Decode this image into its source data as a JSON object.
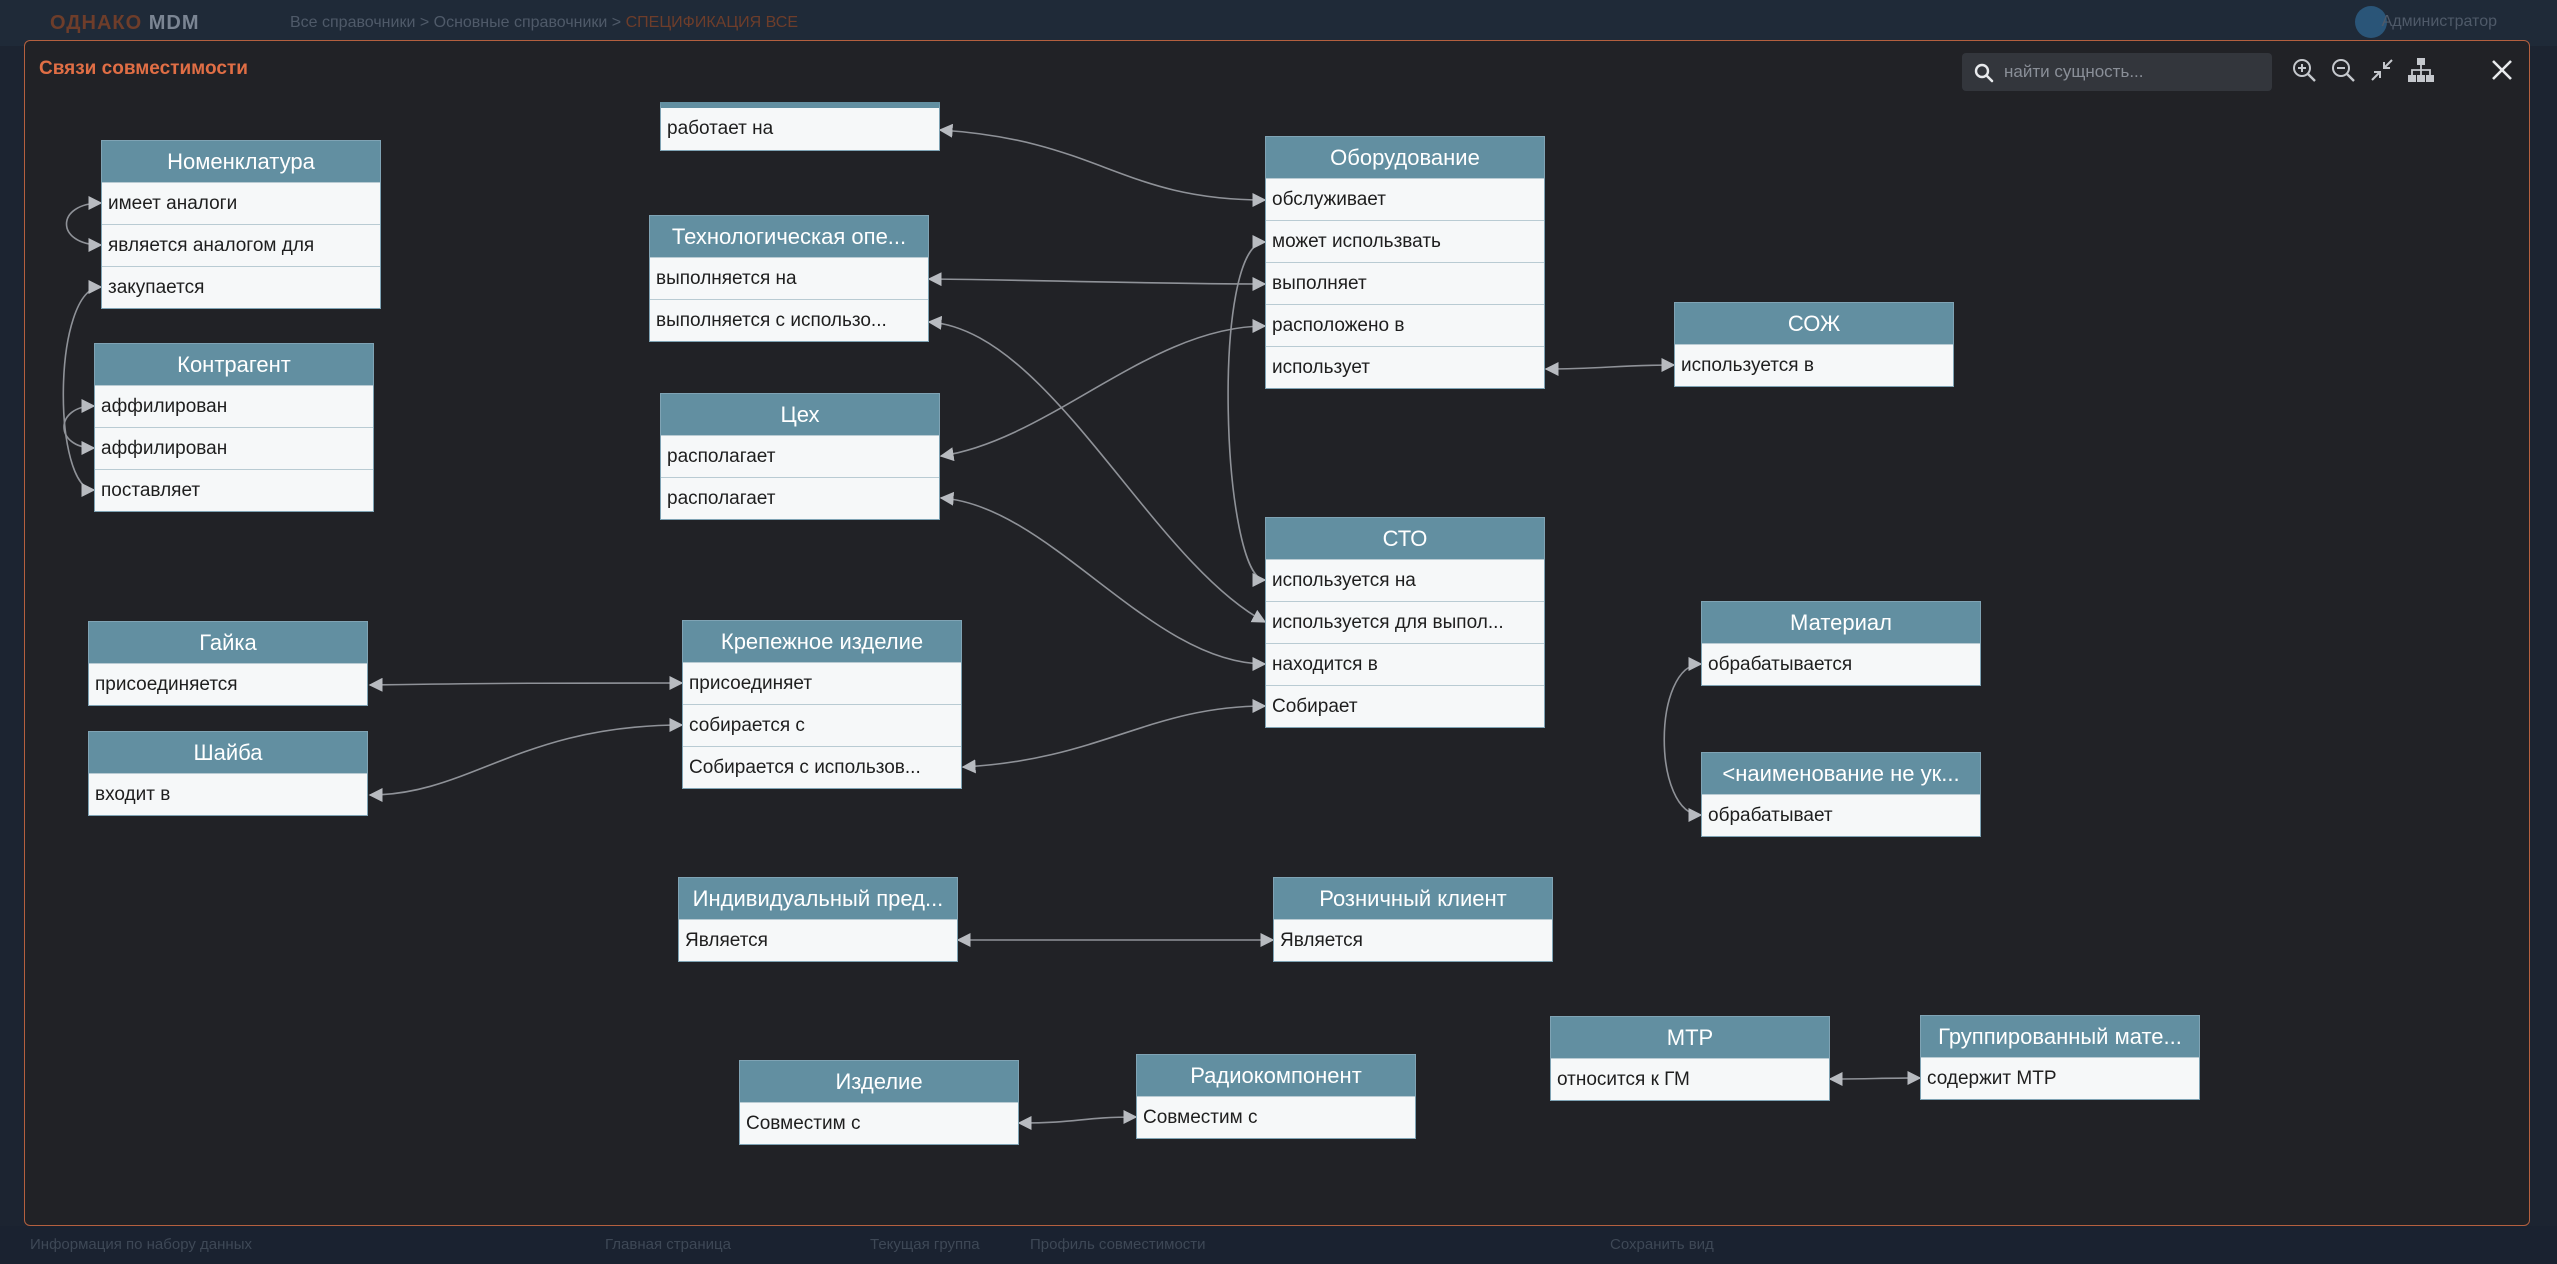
{
  "modal": {
    "title": "Связи совместимости",
    "search_placeholder": "найти сущность...",
    "tools": [
      "zoom-in-icon",
      "zoom-out-icon",
      "collapse-icon",
      "hierarchy-icon",
      "close-icon"
    ]
  },
  "colors": {
    "accent": "#e06e45",
    "border": "#b4603f",
    "entity_header": "#628fa1",
    "entity_body": "#f6f8f9",
    "background": "#212226",
    "link": "#9a9da3"
  },
  "entities": [
    {
      "id": "nomenclature",
      "title": "Номенклатура",
      "rows": [
        "имеет аналоги",
        "является аналогом для",
        "закупается"
      ]
    },
    {
      "id": "contractor",
      "title": "Контрагент",
      "rows": [
        "аффилирован",
        "аффилирован",
        "поставляет"
      ]
    },
    {
      "id": "works-on",
      "title": "",
      "rows": [
        "работает на"
      ]
    },
    {
      "id": "tech-op",
      "title": "Технологическая опе...",
      "rows": [
        "выполняется на",
        "выполняется с использо..."
      ]
    },
    {
      "id": "workshop",
      "title": "Цех",
      "rows": [
        "располагает",
        "располагает"
      ]
    },
    {
      "id": "equipment",
      "title": "Оборудование",
      "rows": [
        "обслуживает",
        "может использвать",
        "выполняет",
        "расположено в",
        "использует"
      ]
    },
    {
      "id": "coolant",
      "title": "СОЖ",
      "rows": [
        "используется в"
      ]
    },
    {
      "id": "sto",
      "title": "СТО",
      "rows": [
        "используется на",
        "используется для выпол...",
        "находится в",
        "Собирает"
      ]
    },
    {
      "id": "material",
      "title": "Материал",
      "rows": [
        "обрабатывается"
      ]
    },
    {
      "id": "unnamed",
      "title": "<наименование не ук...",
      "rows": [
        "обрабатывает"
      ]
    },
    {
      "id": "nut",
      "title": "Гайка",
      "rows": [
        "присоединяется"
      ]
    },
    {
      "id": "washer",
      "title": "Шайба",
      "rows": [
        "входит в"
      ]
    },
    {
      "id": "fastener",
      "title": "Крепежное изделие",
      "rows": [
        "присоединяет",
        "собирается с",
        "Собирается с использов..."
      ]
    },
    {
      "id": "entrepreneur",
      "title": "Индивидуальный пред...",
      "rows": [
        "Является"
      ]
    },
    {
      "id": "retail",
      "title": "Розничный клиент",
      "rows": [
        "Является"
      ]
    },
    {
      "id": "mtr",
      "title": "МТР",
      "rows": [
        "относится к ГМ"
      ]
    },
    {
      "id": "grouped",
      "title": "Группированный мате...",
      "rows": [
        "содержит МТР"
      ]
    },
    {
      "id": "product",
      "title": "Изделие",
      "rows": [
        "Совместим с"
      ]
    },
    {
      "id": "radio",
      "title": "Радиокомпонент",
      "rows": [
        "Совместим с"
      ]
    }
  ],
  "background": {
    "logo": "ОДНАКО",
    "logo_suffix": "MDM",
    "breadcrumb_1": "Все справочники",
    "breadcrumb_2": "Основные справочники",
    "breadcrumb_3": "СПЕЦИФИКАЦИЯ ВСЕ",
    "user": "Администратор",
    "status_left": "Информация по набору данных",
    "status_1": "Главная страница",
    "status_2": "Текущая группа",
    "status_3": "Профиль совместимости",
    "status_right": "Сохранить вид"
  }
}
